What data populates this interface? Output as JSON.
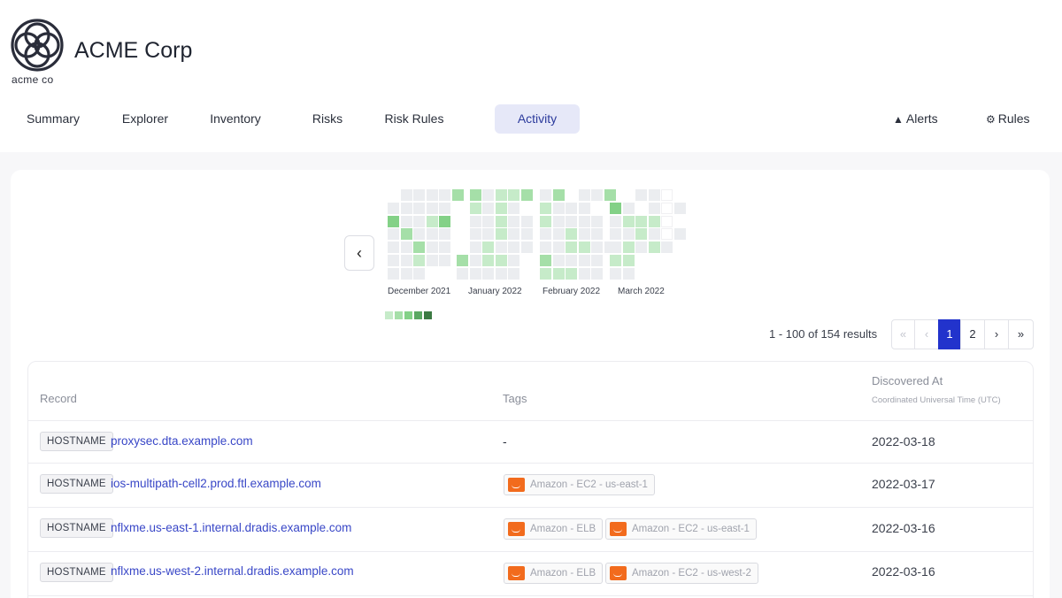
{
  "header": {
    "brand_name": "ACME Corp",
    "logo_text": "acme co",
    "logo_color": "#2a2d3a"
  },
  "nav": {
    "items": [
      {
        "label": "Summary"
      },
      {
        "label": "Explorer"
      },
      {
        "label": "Inventory"
      },
      {
        "label": "Risks"
      },
      {
        "label": "Risk Rules"
      },
      {
        "label": "Activity",
        "active": true
      }
    ],
    "right": [
      {
        "label": "Alerts",
        "icon": "warning-triangle-icon"
      },
      {
        "label": "Rules",
        "icon": "gear-icon"
      }
    ]
  },
  "activity": {
    "back_button_icon": "chevron-left-icon",
    "months": [
      "December 2021",
      "January 2022",
      "February 2022",
      "March 2022"
    ],
    "colors": {
      "empty": "#ebedf0",
      "level1": "#c6ebc9",
      "level2": "#a5dfa8",
      "level3": "#83d187",
      "level4": "#5aa862",
      "level5": "#3b7a43",
      "accent": "#2233cc",
      "link": "#3947c7",
      "aws_orange": "#f26b1d"
    }
  },
  "pagination": {
    "summary": "1 - 100 of 154 results",
    "first": "«",
    "prev": "‹",
    "pages": [
      "1",
      "2"
    ],
    "current_page": "1",
    "next": "›",
    "last": "»"
  },
  "table": {
    "columns": {
      "record": "Record",
      "tags": "Tags",
      "discovered": "Discovered At",
      "discovered_sub": "Coordinated Universal Time (UTC)"
    },
    "rows": [
      {
        "type": "HOSTNAME",
        "record": "proxysec.dta.example.com",
        "tags": [],
        "no_tags": "-",
        "date": "2022-03-18"
      },
      {
        "type": "HOSTNAME",
        "record": "ios-multipath-cell2.prod.ftl.example.com",
        "tags": [
          "Amazon - EC2 - us-east-1"
        ],
        "date": "2022-03-17"
      },
      {
        "type": "HOSTNAME",
        "record": "nflxme.us-east-1.internal.dradis.example.com",
        "tags": [
          "Amazon - ELB",
          "Amazon - EC2 - us-east-1"
        ],
        "date": "2022-03-16"
      },
      {
        "type": "HOSTNAME",
        "record": "nflxme.us-west-2.internal.dradis.example.com",
        "tags": [
          "Amazon - ELB",
          "Amazon - EC2 - us-west-2"
        ],
        "date": "2022-03-16"
      }
    ]
  }
}
